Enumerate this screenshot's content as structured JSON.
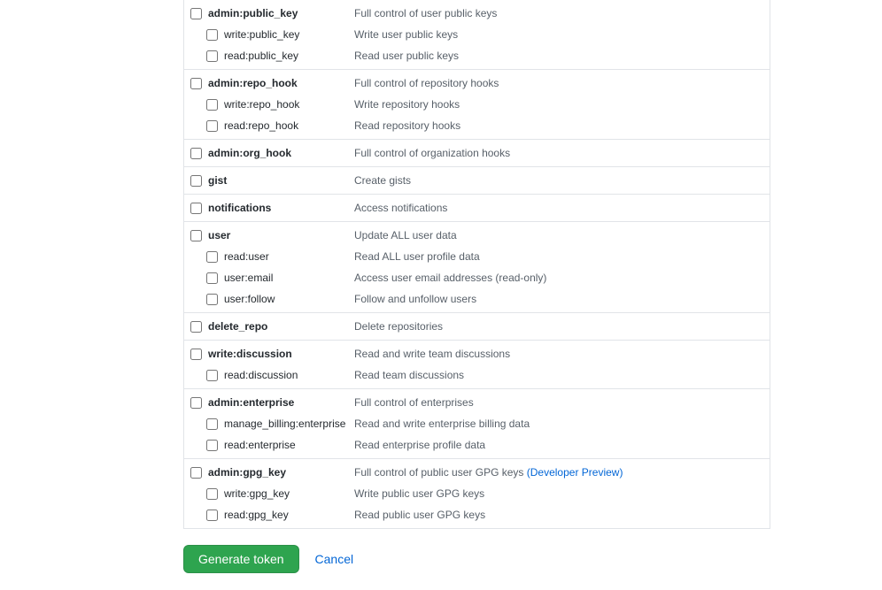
{
  "scopes": [
    {
      "parent": {
        "name": "admin:public_key",
        "desc": "Full control of user public keys"
      },
      "children": [
        {
          "name": "write:public_key",
          "desc": "Write user public keys"
        },
        {
          "name": "read:public_key",
          "desc": "Read user public keys"
        }
      ]
    },
    {
      "parent": {
        "name": "admin:repo_hook",
        "desc": "Full control of repository hooks"
      },
      "children": [
        {
          "name": "write:repo_hook",
          "desc": "Write repository hooks"
        },
        {
          "name": "read:repo_hook",
          "desc": "Read repository hooks"
        }
      ]
    },
    {
      "parent": {
        "name": "admin:org_hook",
        "desc": "Full control of organization hooks"
      },
      "children": []
    },
    {
      "parent": {
        "name": "gist",
        "desc": "Create gists"
      },
      "children": []
    },
    {
      "parent": {
        "name": "notifications",
        "desc": "Access notifications"
      },
      "children": []
    },
    {
      "parent": {
        "name": "user",
        "desc": "Update ALL user data"
      },
      "children": [
        {
          "name": "read:user",
          "desc": "Read ALL user profile data"
        },
        {
          "name": "user:email",
          "desc": "Access user email addresses (read-only)"
        },
        {
          "name": "user:follow",
          "desc": "Follow and unfollow users"
        }
      ]
    },
    {
      "parent": {
        "name": "delete_repo",
        "desc": "Delete repositories"
      },
      "children": []
    },
    {
      "parent": {
        "name": "write:discussion",
        "desc": "Read and write team discussions"
      },
      "children": [
        {
          "name": "read:discussion",
          "desc": "Read team discussions"
        }
      ]
    },
    {
      "parent": {
        "name": "admin:enterprise",
        "desc": "Full control of enterprises"
      },
      "children": [
        {
          "name": "manage_billing:enterprise",
          "desc": "Read and write enterprise billing data"
        },
        {
          "name": "read:enterprise",
          "desc": "Read enterprise profile data"
        }
      ]
    },
    {
      "parent": {
        "name": "admin:gpg_key",
        "desc": "Full control of public user GPG keys ",
        "preview": "(Developer Preview)"
      },
      "children": [
        {
          "name": "write:gpg_key",
          "desc": "Write public user GPG keys"
        },
        {
          "name": "read:gpg_key",
          "desc": "Read public user GPG keys"
        }
      ]
    }
  ],
  "actions": {
    "generate": "Generate token",
    "cancel": "Cancel"
  }
}
